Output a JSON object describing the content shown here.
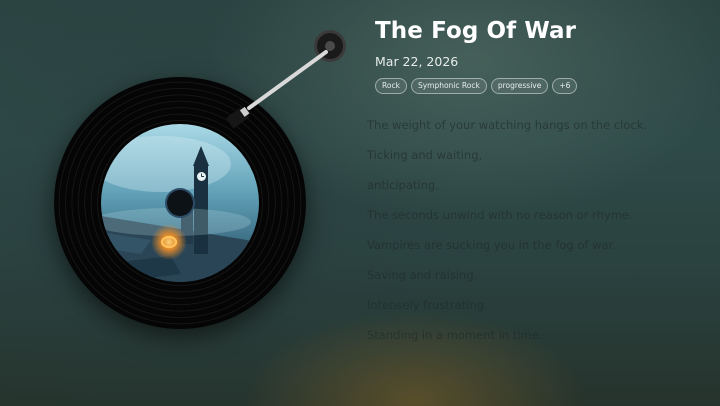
{
  "song": {
    "title": "The Fog Of War",
    "date": "Mar 22, 2026"
  },
  "tags": [
    "Rock",
    "Symphonic Rock",
    "progressive",
    "+6"
  ],
  "lyrics": [
    "The weight of your watching hangs on the clock.",
    "Ticking and waiting,",
    "anticipating.",
    "The seconds unwind with no reason or rhyme.",
    "Vampires are sucking you in the fog of war.",
    "Saving and raising.",
    "Intensely frustrating.",
    "Standing in a moment in time."
  ],
  "colors": {
    "background": "#2b4442",
    "title": "#ffffff",
    "lyrics": "#1e2a28",
    "accent_glow": "#e0a030"
  },
  "icons": {
    "album_art": "clock-tower-art",
    "tonearm": "tonearm-icon"
  }
}
